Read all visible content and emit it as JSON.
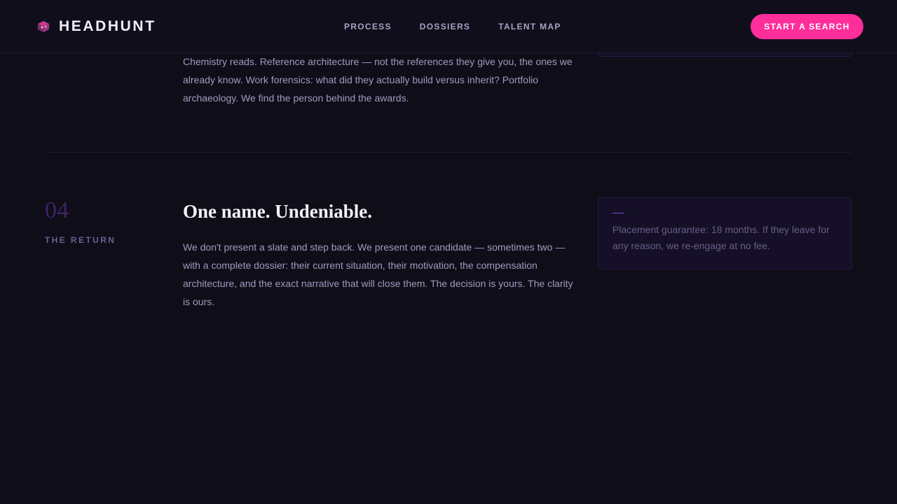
{
  "header": {
    "brand": "HEADHUNT",
    "nav": [
      "PROCESS",
      "DOSSIERS",
      "TALENT MAP"
    ],
    "cta_label": "START A SEARCH"
  },
  "previous_section": {
    "body": "Chemistry reads. Reference architecture — not the references they give you, the ones we already know. Work forensics: what did they actually build versus inherit? Portfolio archaeology. We find the person behind the awards."
  },
  "step": {
    "number": "04",
    "label": "THE RETURN",
    "title": "One name. Undeniable.",
    "body": "We don't present a slate and step back. We present one candidate — sometimes two — with a complete dossier: their current situation, their motivation, the compensation architecture, and the exact narrative that will close them. The decision is yours. The clarity is ours.",
    "note": "Placement guarantee: 18 months. If they leave for any reason, we re-engage at no fee."
  },
  "colors": {
    "background": "#0f0d18",
    "accent": "#ff2e9a",
    "step_number": "#3d2466",
    "note_dash": "#8a3fd0"
  },
  "icons": {
    "logo": "cube-logo-icon"
  }
}
